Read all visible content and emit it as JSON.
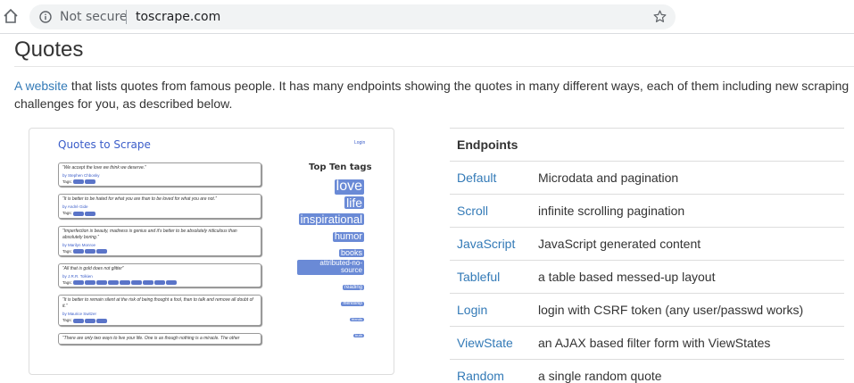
{
  "browser": {
    "security_label": "Not secure",
    "url": "toscrape.com",
    "icons": [
      "home-icon",
      "info-icon",
      "star-icon"
    ]
  },
  "page": {
    "title": "Quotes",
    "intro_link": "A website",
    "intro_text": " that lists quotes from famous people. It has many endpoints showing the quotes in many different ways, each of them including new scraping challenges for you, as described below."
  },
  "preview": {
    "brand": "Quotes to Scrape",
    "login": "Login",
    "top_tags_title": "Top Ten tags",
    "quotes": [
      {
        "text": "“We accept the love we think we deserve.”",
        "author": "Stephen Chbosky",
        "tags": 2
      },
      {
        "text": "“It is better to be hated for what you are than to be loved for what you are not.”",
        "author": "André Gide",
        "tags": 2
      },
      {
        "text": "“Imperfection is beauty, madness is genius and it's better to be absolutely ridiculous than absolutely boring.”",
        "author": "Marilyn Monroe",
        "tags": 3
      },
      {
        "text": "“All that is gold does not glitter”",
        "author": "J.R.R. Tolkien",
        "tags": 9
      },
      {
        "text": "“It is better to remain silent at the risk of being thought a fool, than to talk and remove all doubt of it.”",
        "author": "Maurice Switzer",
        "tags": 3
      },
      {
        "text": "“There are only two ways to live your life. One is as though nothing is a miracle. The other",
        "author": "",
        "tags": 0
      }
    ],
    "top_tags": [
      "love",
      "life",
      "inspirational",
      "humor",
      "books",
      "attributed-no-source",
      "reading",
      "friendship",
      "friends",
      "truth"
    ],
    "tag_sizes": [
      16,
      14,
      13,
      11,
      9,
      8,
      6,
      5,
      4,
      4
    ],
    "by_label": "by",
    "tags_label": "Tags:"
  },
  "endpoints": {
    "header": "Endpoints",
    "rows": [
      {
        "name": "Default",
        "desc": "Microdata and pagination"
      },
      {
        "name": "Scroll",
        "desc": "infinite scrolling pagination"
      },
      {
        "name": "JavaScript",
        "desc": "JavaScript generated content"
      },
      {
        "name": "Tableful",
        "desc": "a table based messed-up layout"
      },
      {
        "name": "Login",
        "desc": "login with CSRF token (any user/passwd works)"
      },
      {
        "name": "ViewState",
        "desc": "an AJAX based filter form with ViewStates"
      },
      {
        "name": "Random",
        "desc": "a single random quote"
      }
    ]
  }
}
